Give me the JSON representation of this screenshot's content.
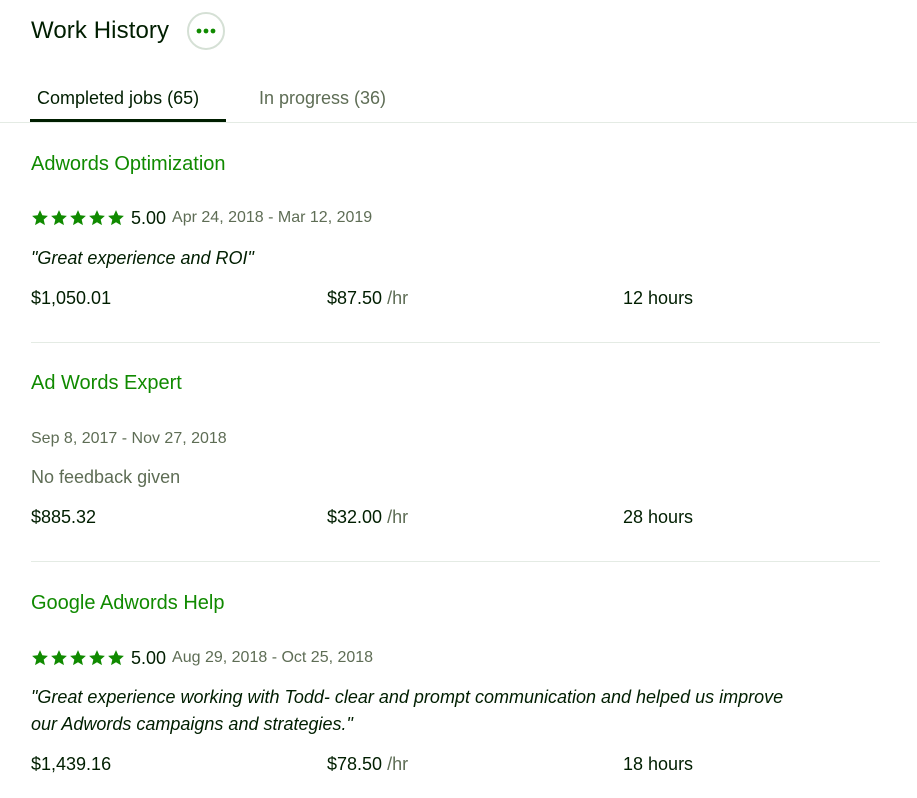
{
  "header": {
    "title": "Work History",
    "more_icon": "more-horizontal-icon"
  },
  "tabs": [
    {
      "label": "Completed jobs (65)",
      "active": true
    },
    {
      "label": "In progress (36)",
      "active": false
    }
  ],
  "colors": {
    "accent": "#108a00",
    "text": "#001e00",
    "muted": "#5e6d55",
    "divider": "#e4ebe4"
  },
  "jobs": [
    {
      "title": "Adwords Optimization",
      "rating": 5,
      "score": "5.00",
      "dates": "Apr 24, 2018 - Mar 12, 2019",
      "feedback": "\"Great experience and ROI\"",
      "earned": "$1,050.01",
      "rate": "$87.50",
      "rate_unit": " /hr",
      "hours": "12",
      "hours_unit": " hours"
    },
    {
      "title": "Ad Words Expert",
      "dates": "Sep 8, 2017 - Nov 27, 2018",
      "feedback": "No feedback given",
      "earned": "$885.32",
      "rate": "$32.00",
      "rate_unit": " /hr",
      "hours": "28",
      "hours_unit": " hours"
    },
    {
      "title": "Google Adwords Help",
      "rating": 5,
      "score": "5.00",
      "dates": "Aug 29, 2018 - Oct 25, 2018",
      "feedback_line1": "\"Great experience working with Todd- clear and prompt communication and helped us improve",
      "feedback_line2": "our Adwords campaigns and strategies.\"",
      "earned": "$1,439.16",
      "rate": "$78.50",
      "rate_unit": " /hr",
      "hours": "18",
      "hours_unit": " hours"
    }
  ]
}
